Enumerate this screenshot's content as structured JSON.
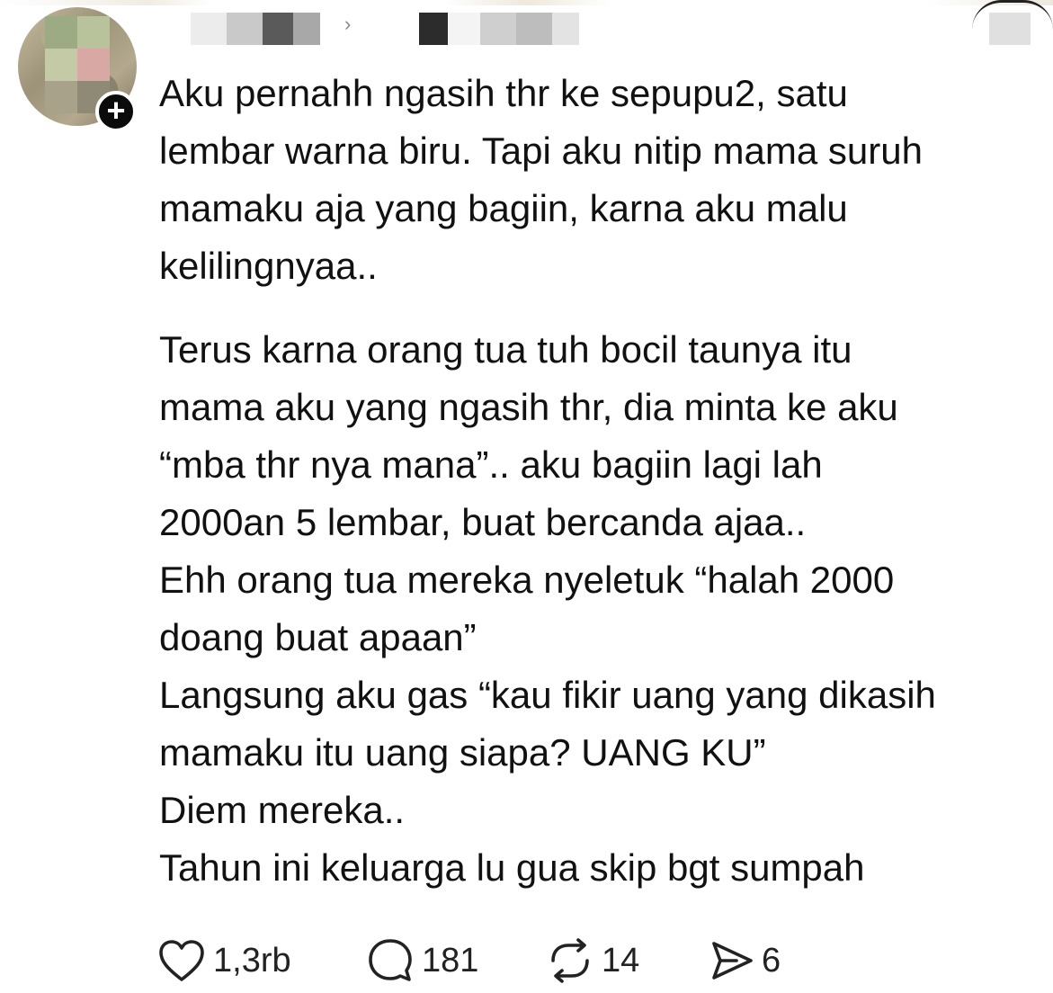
{
  "header": {
    "chevron": "›"
  },
  "avatar": {
    "follow_badge": "+"
  },
  "post": {
    "lines": [
      "Aku pernahh ngasih thr ke sepupu2, satu",
      "lembar warna biru. Tapi aku nitip mama suruh",
      "mamaku aja yang bagiin, karna aku malu",
      "kelilingnyaa..",
      "Terus karna orang tua tuh bocil taunya itu",
      "mama aku yang ngasih thr, dia minta ke aku",
      "“mba thr nya mana”.. aku bagiin lagi lah",
      "2000an 5 lembar, buat bercanda ajaa..",
      "Ehh orang tua mereka nyeletuk “halah 2000",
      "doang buat apaan”",
      "Langsung aku gas “kau fikir uang yang dikasih",
      "mamaku itu uang siapa? UANG KU”",
      "Diem mereka..",
      "Tahun ini keluarga lu gua skip bgt sumpah"
    ]
  },
  "actions": {
    "like": {
      "icon": "heart-icon",
      "count": "1,3rb"
    },
    "reply": {
      "icon": "comment-icon",
      "count": "181"
    },
    "repost": {
      "icon": "repost-icon",
      "count": "14"
    },
    "share": {
      "icon": "send-icon",
      "count": "6"
    }
  }
}
